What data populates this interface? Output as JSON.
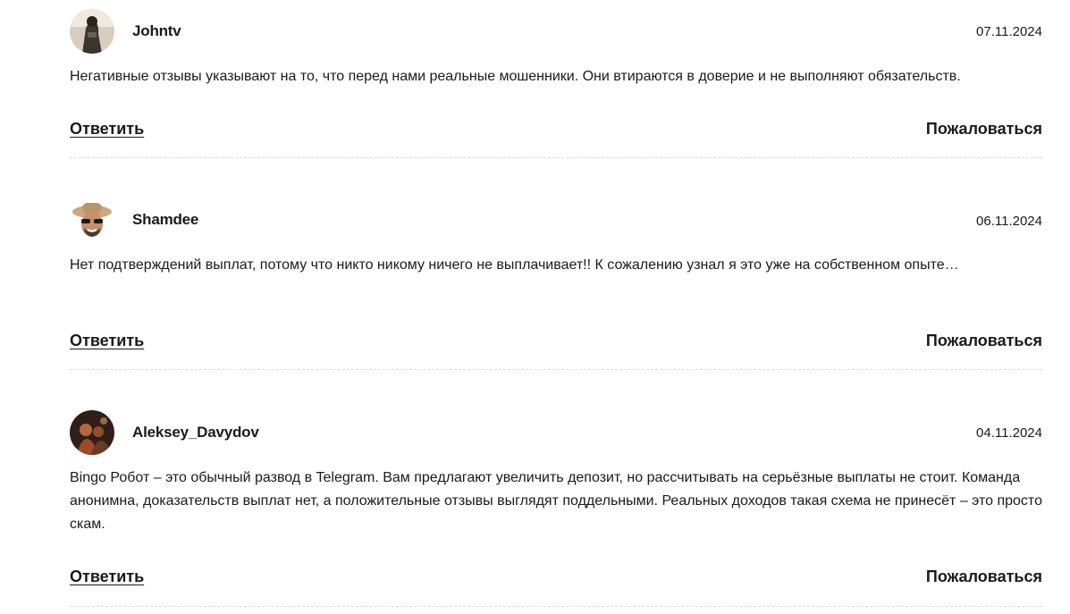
{
  "comments": [
    {
      "author": "Johntv",
      "date": "07.11.2024",
      "text": "Негативные отзывы указывают на то, что перед нами реальные мошенники. Они втираются в доверие и не выполняют обязательств.",
      "reply_label": "Ответить",
      "report_label": "Пожаловаться"
    },
    {
      "author": "Shamdee",
      "date": "06.11.2024",
      "text": "Нет подтверждений выплат, потому что никто никому ничего не выплачивает!! К сожалению узнал я это уже на собственном опыте…",
      "reply_label": "Ответить",
      "report_label": "Пожаловаться"
    },
    {
      "author": "Aleksey_Davydov",
      "date": "04.11.2024",
      "text": "Bingo Робот – это обычный развод в Telegram. Вам предлагают увеличить депозит, но рассчитывать на серьёзные выплаты не стоит. Команда анонимна, доказательств выплат нет, а положительные отзывы выглядят поддельными. Реальных доходов такая схема не принесёт – это просто скам.",
      "reply_label": "Ответить",
      "report_label": "Пожаловаться"
    }
  ]
}
